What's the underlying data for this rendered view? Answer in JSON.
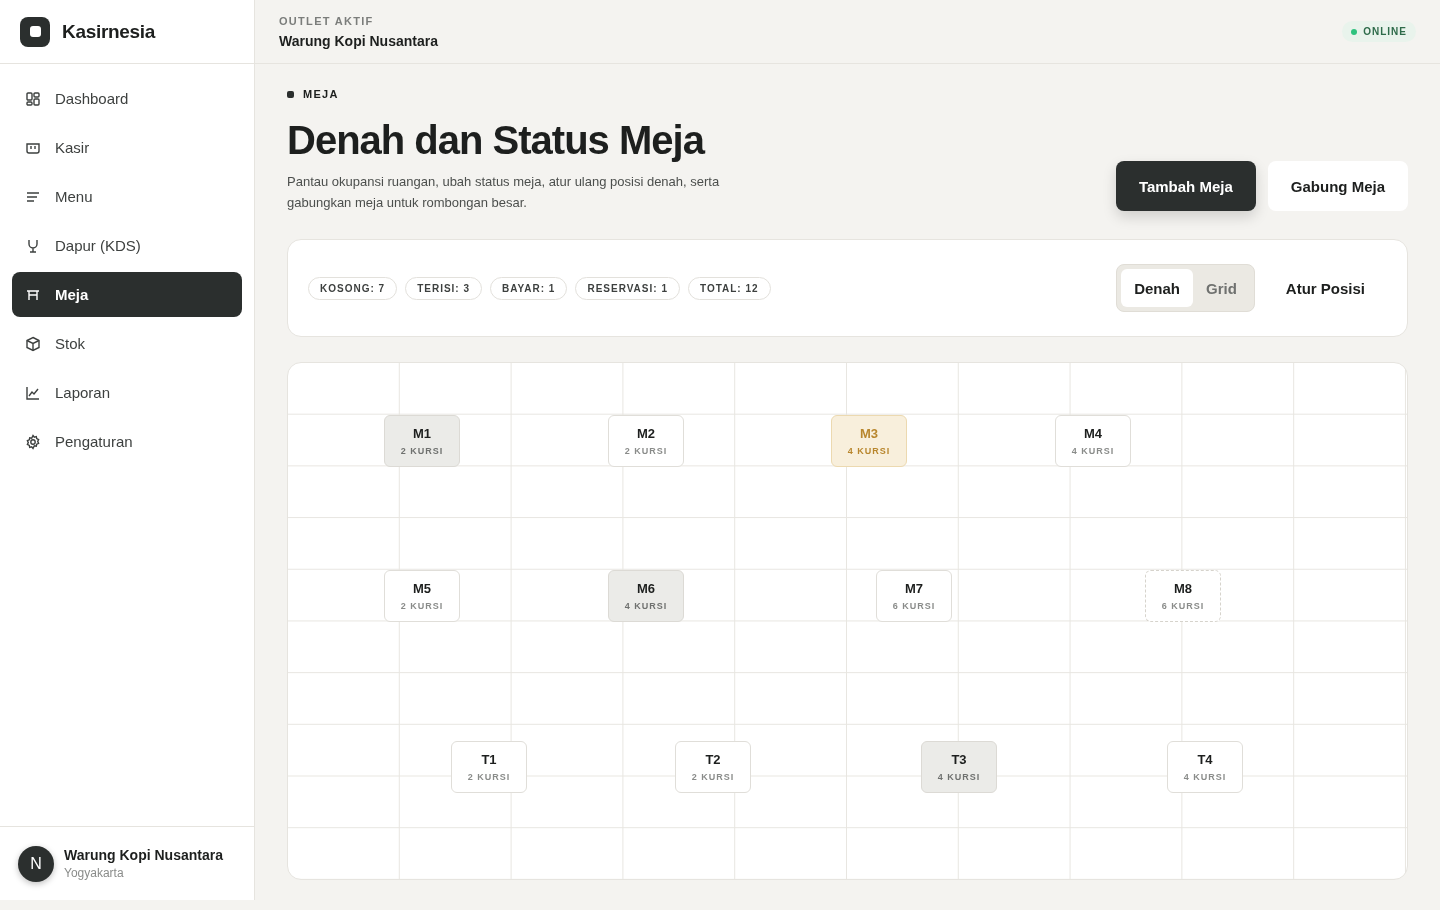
{
  "brand": {
    "name": "Kasirnesia"
  },
  "sidebar": {
    "items": [
      {
        "label": "Dashboard",
        "selected": false
      },
      {
        "label": "Kasir",
        "selected": false
      },
      {
        "label": "Menu",
        "selected": false
      },
      {
        "label": "Dapur (KDS)",
        "selected": false
      },
      {
        "label": "Meja",
        "selected": true
      },
      {
        "label": "Stok",
        "selected": false
      },
      {
        "label": "Laporan",
        "selected": false
      },
      {
        "label": "Pengaturan",
        "selected": false
      }
    ],
    "account": {
      "initial": "N",
      "name": "Warung Kopi Nusantara",
      "city": "Yogyakarta"
    }
  },
  "header": {
    "eyebrow": "OUTLET AKTIF",
    "outlet": "Warung Kopi Nusantara",
    "status": "ONLINE"
  },
  "page": {
    "section": "MEJA",
    "title": "Denah dan Status Meja",
    "description": "Pantau okupansi ruangan, ubah status meja, atur ulang posisi denah, serta gabungkan meja untuk rombongan besar.",
    "actions": [
      {
        "label": "Tambah Meja",
        "kind": "primary"
      },
      {
        "label": "Gabung Meja",
        "kind": "secondary"
      }
    ]
  },
  "summary": {
    "chips": [
      "KOSONG: 7",
      "TERISI: 3",
      "BAYAR: 1",
      "RESERVASI: 1",
      "TOTAL: 12"
    ],
    "views": [
      {
        "label": "Denah",
        "selected": true
      },
      {
        "label": "Grid",
        "selected": false
      }
    ],
    "arrange": "Atur Posisi"
  },
  "tables": [
    {
      "name": "M1",
      "seats": "2 KURSI",
      "kind": "occupied"
    },
    {
      "name": "M2",
      "seats": "2 KURSI",
      "kind": "empty"
    },
    {
      "name": "M3",
      "seats": "4 KURSI",
      "kind": "paying"
    },
    {
      "name": "M4",
      "seats": "4 KURSI",
      "kind": "empty"
    },
    {
      "name": "M5",
      "seats": "2 KURSI",
      "kind": "empty"
    },
    {
      "name": "M6",
      "seats": "4 KURSI",
      "kind": "occupied"
    },
    {
      "name": "M7",
      "seats": "6 KURSI",
      "kind": "empty"
    },
    {
      "name": "M8",
      "seats": "6 KURSI",
      "kind": "reserved"
    },
    {
      "name": "T1",
      "seats": "2 KURSI",
      "kind": "empty"
    },
    {
      "name": "T2",
      "seats": "2 KURSI",
      "kind": "empty"
    },
    {
      "name": "T3",
      "seats": "4 KURSI",
      "kind": "occupied"
    },
    {
      "name": "T4",
      "seats": "4 KURSI",
      "kind": "empty"
    }
  ]
}
